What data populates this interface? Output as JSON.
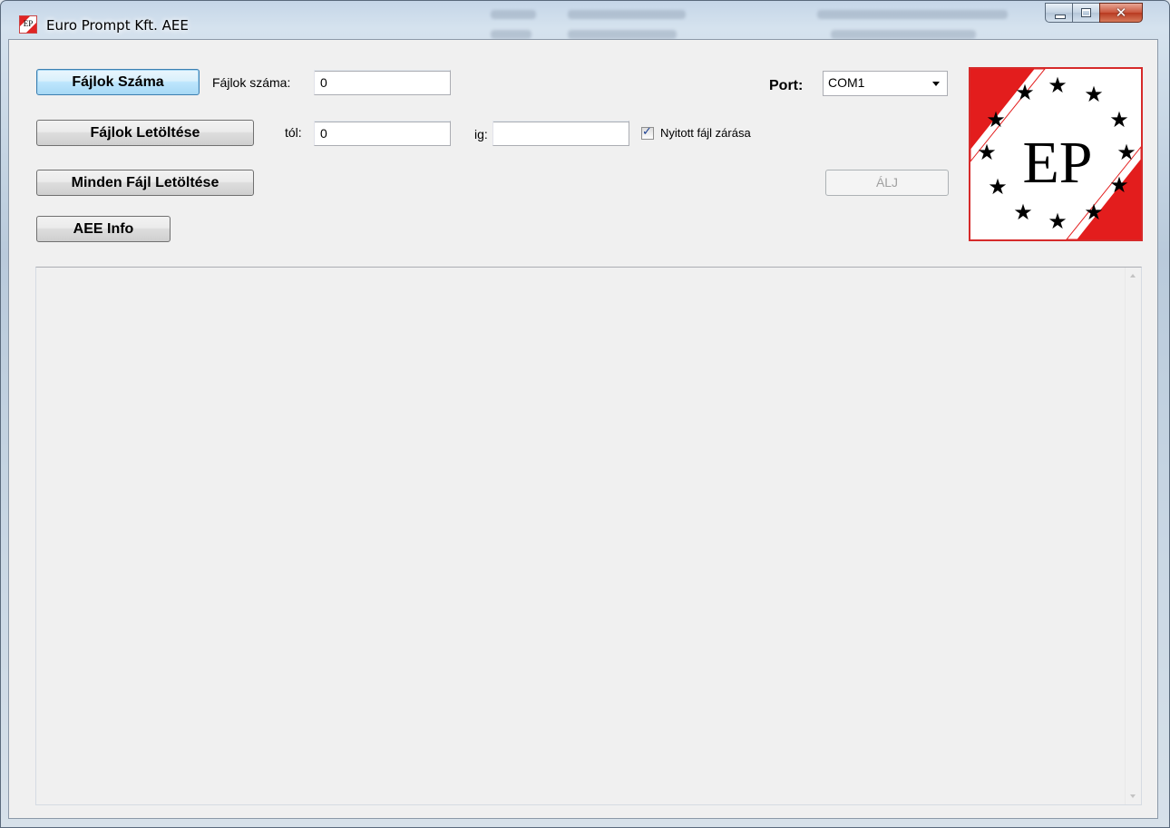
{
  "window": {
    "title": "Euro Prompt Kft. AEE",
    "icon_text": "EP"
  },
  "toolbar": {
    "count_button": "Fájlok Száma",
    "download_button": "Fájlok Letöltése",
    "download_all_button": "Minden Fájl Letöltése",
    "info_button": "AEE Info",
    "stop_button": "ÁLJ"
  },
  "fields": {
    "count_label": "Fájlok száma:",
    "count_value": "0",
    "from_label": "tól:",
    "from_value": "0",
    "to_label": "ig:",
    "to_value": ""
  },
  "checkbox": {
    "label": "Nyitott fájl zárása",
    "checked": true
  },
  "port": {
    "label": "Port:",
    "value": "COM1"
  },
  "logo": {
    "letters": "EP"
  },
  "log": {
    "text": ""
  },
  "colors": {
    "logo_red": "#e31d1d",
    "default_button_border": "#3c7fb1",
    "client_bg": "#f0f0f0"
  }
}
